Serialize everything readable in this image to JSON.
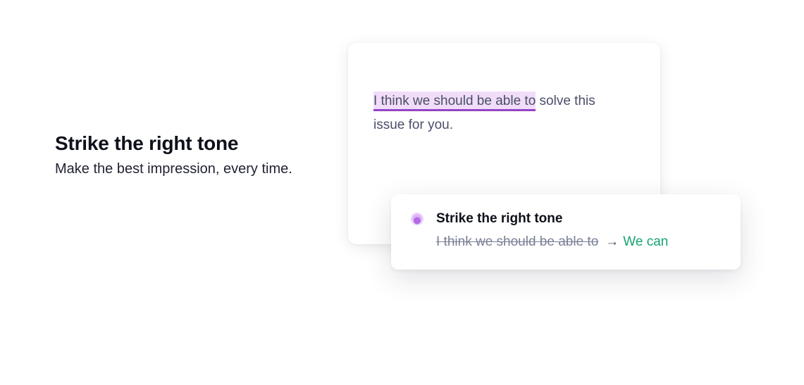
{
  "intro": {
    "heading": "Strike the right tone",
    "description": "Make the best impression, every time."
  },
  "editor": {
    "highlighted_text": "I think we should be able to",
    "rest_text": " solve this issue for you.",
    "highlight_color": "#f1ddf9",
    "underline_color": "#9445c6"
  },
  "suggestion": {
    "icon": "tone-icon",
    "title": "Strike the right tone",
    "old_text": "I think we should be able to",
    "arrow": "→",
    "new_text": "We can",
    "new_text_color": "#15a56f",
    "icon_color": "#c07ae8"
  }
}
